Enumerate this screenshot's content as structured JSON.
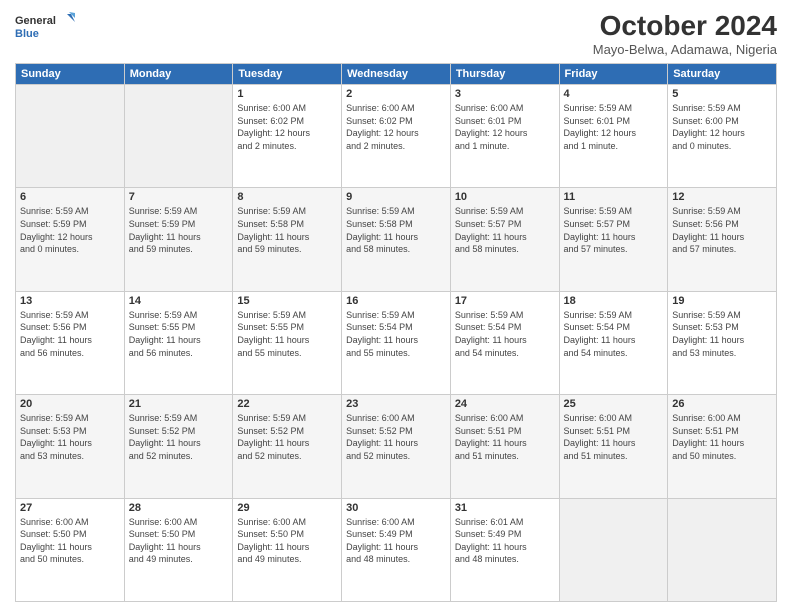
{
  "header": {
    "logo_line1": "General",
    "logo_line2": "Blue",
    "month_title": "October 2024",
    "location": "Mayo-Belwa, Adamawa, Nigeria"
  },
  "days_of_week": [
    "Sunday",
    "Monday",
    "Tuesday",
    "Wednesday",
    "Thursday",
    "Friday",
    "Saturday"
  ],
  "weeks": [
    [
      {
        "day": "",
        "info": ""
      },
      {
        "day": "",
        "info": ""
      },
      {
        "day": "1",
        "info": "Sunrise: 6:00 AM\nSunset: 6:02 PM\nDaylight: 12 hours\nand 2 minutes."
      },
      {
        "day": "2",
        "info": "Sunrise: 6:00 AM\nSunset: 6:02 PM\nDaylight: 12 hours\nand 2 minutes."
      },
      {
        "day": "3",
        "info": "Sunrise: 6:00 AM\nSunset: 6:01 PM\nDaylight: 12 hours\nand 1 minute."
      },
      {
        "day": "4",
        "info": "Sunrise: 5:59 AM\nSunset: 6:01 PM\nDaylight: 12 hours\nand 1 minute."
      },
      {
        "day": "5",
        "info": "Sunrise: 5:59 AM\nSunset: 6:00 PM\nDaylight: 12 hours\nand 0 minutes."
      }
    ],
    [
      {
        "day": "6",
        "info": "Sunrise: 5:59 AM\nSunset: 5:59 PM\nDaylight: 12 hours\nand 0 minutes."
      },
      {
        "day": "7",
        "info": "Sunrise: 5:59 AM\nSunset: 5:59 PM\nDaylight: 11 hours\nand 59 minutes."
      },
      {
        "day": "8",
        "info": "Sunrise: 5:59 AM\nSunset: 5:58 PM\nDaylight: 11 hours\nand 59 minutes."
      },
      {
        "day": "9",
        "info": "Sunrise: 5:59 AM\nSunset: 5:58 PM\nDaylight: 11 hours\nand 58 minutes."
      },
      {
        "day": "10",
        "info": "Sunrise: 5:59 AM\nSunset: 5:57 PM\nDaylight: 11 hours\nand 58 minutes."
      },
      {
        "day": "11",
        "info": "Sunrise: 5:59 AM\nSunset: 5:57 PM\nDaylight: 11 hours\nand 57 minutes."
      },
      {
        "day": "12",
        "info": "Sunrise: 5:59 AM\nSunset: 5:56 PM\nDaylight: 11 hours\nand 57 minutes."
      }
    ],
    [
      {
        "day": "13",
        "info": "Sunrise: 5:59 AM\nSunset: 5:56 PM\nDaylight: 11 hours\nand 56 minutes."
      },
      {
        "day": "14",
        "info": "Sunrise: 5:59 AM\nSunset: 5:55 PM\nDaylight: 11 hours\nand 56 minutes."
      },
      {
        "day": "15",
        "info": "Sunrise: 5:59 AM\nSunset: 5:55 PM\nDaylight: 11 hours\nand 55 minutes."
      },
      {
        "day": "16",
        "info": "Sunrise: 5:59 AM\nSunset: 5:54 PM\nDaylight: 11 hours\nand 55 minutes."
      },
      {
        "day": "17",
        "info": "Sunrise: 5:59 AM\nSunset: 5:54 PM\nDaylight: 11 hours\nand 54 minutes."
      },
      {
        "day": "18",
        "info": "Sunrise: 5:59 AM\nSunset: 5:54 PM\nDaylight: 11 hours\nand 54 minutes."
      },
      {
        "day": "19",
        "info": "Sunrise: 5:59 AM\nSunset: 5:53 PM\nDaylight: 11 hours\nand 53 minutes."
      }
    ],
    [
      {
        "day": "20",
        "info": "Sunrise: 5:59 AM\nSunset: 5:53 PM\nDaylight: 11 hours\nand 53 minutes."
      },
      {
        "day": "21",
        "info": "Sunrise: 5:59 AM\nSunset: 5:52 PM\nDaylight: 11 hours\nand 52 minutes."
      },
      {
        "day": "22",
        "info": "Sunrise: 5:59 AM\nSunset: 5:52 PM\nDaylight: 11 hours\nand 52 minutes."
      },
      {
        "day": "23",
        "info": "Sunrise: 6:00 AM\nSunset: 5:52 PM\nDaylight: 11 hours\nand 52 minutes."
      },
      {
        "day": "24",
        "info": "Sunrise: 6:00 AM\nSunset: 5:51 PM\nDaylight: 11 hours\nand 51 minutes."
      },
      {
        "day": "25",
        "info": "Sunrise: 6:00 AM\nSunset: 5:51 PM\nDaylight: 11 hours\nand 51 minutes."
      },
      {
        "day": "26",
        "info": "Sunrise: 6:00 AM\nSunset: 5:51 PM\nDaylight: 11 hours\nand 50 minutes."
      }
    ],
    [
      {
        "day": "27",
        "info": "Sunrise: 6:00 AM\nSunset: 5:50 PM\nDaylight: 11 hours\nand 50 minutes."
      },
      {
        "day": "28",
        "info": "Sunrise: 6:00 AM\nSunset: 5:50 PM\nDaylight: 11 hours\nand 49 minutes."
      },
      {
        "day": "29",
        "info": "Sunrise: 6:00 AM\nSunset: 5:50 PM\nDaylight: 11 hours\nand 49 minutes."
      },
      {
        "day": "30",
        "info": "Sunrise: 6:00 AM\nSunset: 5:49 PM\nDaylight: 11 hours\nand 48 minutes."
      },
      {
        "day": "31",
        "info": "Sunrise: 6:01 AM\nSunset: 5:49 PM\nDaylight: 11 hours\nand 48 minutes."
      },
      {
        "day": "",
        "info": ""
      },
      {
        "day": "",
        "info": ""
      }
    ]
  ]
}
